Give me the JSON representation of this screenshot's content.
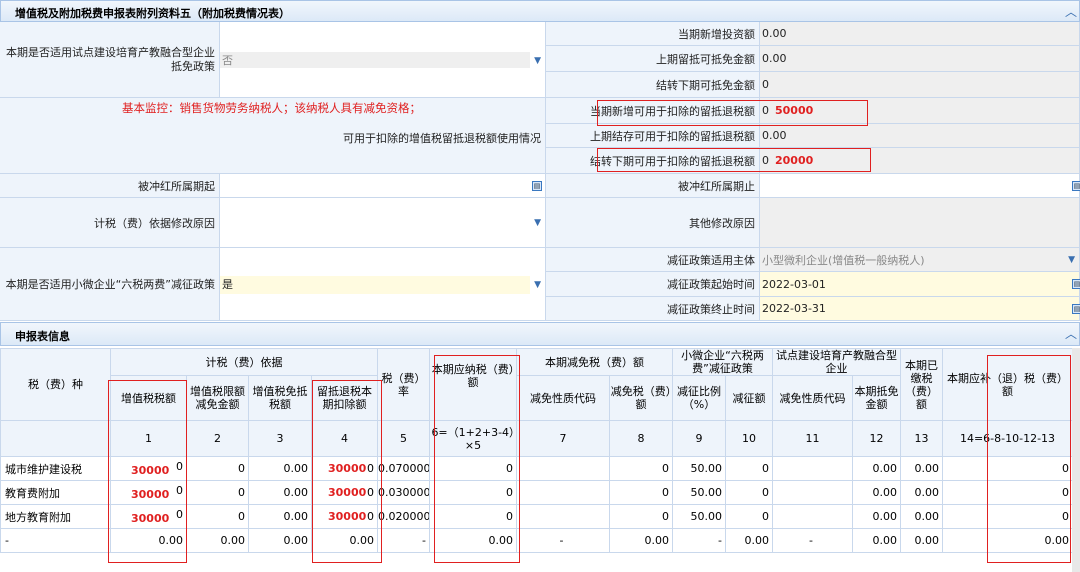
{
  "sections": {
    "main_title": "增值税及附加税费申报表附列资料五（附加税费情况表）",
    "sub_title": "申报表信息"
  },
  "form": {
    "pilot_policy_label": "本期是否适用试点建设培育产教融合型企业抵免政策",
    "pilot_policy_value": "否",
    "monitor_note": "基本监控：销售货物劳务纳税人；该纳税人具有减免资格；",
    "refund_usage_label": "可用于扣除的增值税留抵退税额使用情况",
    "new_investment_label": "当期新增投资额",
    "new_investment_value": "0.00",
    "prev_credit_label": "上期留抵可抵免金额",
    "prev_credit_value": "0.00",
    "carry_credit_label": "结转下期可抵免金额",
    "carry_credit_value": "0",
    "new_refund_label": "当期新增可用于扣除的留抵退税额",
    "new_refund_value": "0",
    "new_refund_note": "50000",
    "prev_refund_label": "上期结存可用于扣除的留抵退税额",
    "prev_refund_value": "0.00",
    "carry_refund_label": "结转下期可用于扣除的留抵退税额",
    "carry_refund_value": "0",
    "carry_refund_note": "20000",
    "red_start_label": "被冲红所属期起",
    "red_end_label": "被冲红所属期止",
    "basis_reason_label": "计税（费）依据修改原因",
    "other_reason_label": "其他修改原因",
    "six_tax_label": "本期是否适用小微企业“六税两费”减征政策",
    "six_tax_value": "是",
    "reduce_subject_label": "减征政策适用主体",
    "reduce_subject_value": "小型微利企业(增值税一般纳税人)",
    "reduce_start_label": "减征政策起始时间",
    "reduce_start_value": "2022-03-01",
    "reduce_end_label": "减征政策终止时间",
    "reduce_end_value": "2022-03-31"
  },
  "table": {
    "h": {
      "tax_type": "税（费）种",
      "basis": "计税（费）依据",
      "c1": "增值税税额",
      "c2": "增值税限额减免金额",
      "c3": "增值税免抵税额",
      "c4": "留抵退税本期扣除额",
      "rate": "税（费）率",
      "payable": "本期应纳税（费）额",
      "reduce": "本期减免税（费）额",
      "r_code": "减免性质代码",
      "r_amt": "减免税（费）额",
      "small": "小微企业“六税两费”减征政策",
      "ratio": "减征比例（%）",
      "r_amount": "减征额",
      "pilot": "试点建设培育产教融合型企业",
      "p_code": "减免性质代码",
      "p_amt": "本期抵免金额",
      "paid": "本期已缴税（费）额",
      "due": "本期应补（退）税（费）额"
    },
    "nums": [
      "1",
      "2",
      "3",
      "4",
      "5",
      "6=（1+2+3-4）×5",
      "7",
      "8",
      "9",
      "10",
      "11",
      "12",
      "13",
      "14=6-8-10-12-13"
    ],
    "rows": [
      {
        "name": "城市维护建设税",
        "v1": "0",
        "n1": "30000",
        "v2": "0",
        "v3": "0.00",
        "v4": "0",
        "n4": "30000",
        "v5": "0.070000",
        "v6": "0",
        "v7": "",
        "v8": "0",
        "v9": "50.00",
        "v10": "0",
        "v11": "",
        "v12": "0.00",
        "v13": "0.00",
        "v14": "0"
      },
      {
        "name": "教育费附加",
        "v1": "0",
        "n1": "30000",
        "v2": "0",
        "v3": "0.00",
        "v4": "0",
        "n4": "30000",
        "v5": "0.030000",
        "v6": "0",
        "v7": "",
        "v8": "0",
        "v9": "50.00",
        "v10": "0",
        "v11": "",
        "v12": "0.00",
        "v13": "0.00",
        "v14": "0"
      },
      {
        "name": "地方教育附加",
        "v1": "0",
        "n1": "30000",
        "v2": "0",
        "v3": "0.00",
        "v4": "0",
        "n4": "30000",
        "v5": "0.020000",
        "v6": "0",
        "v7": "",
        "v8": "0",
        "v9": "50.00",
        "v10": "0",
        "v11": "",
        "v12": "0.00",
        "v13": "0.00",
        "v14": "0"
      },
      {
        "name": "-",
        "v1": "0.00",
        "n1": "",
        "v2": "0.00",
        "v3": "0.00",
        "v4": "0.00",
        "n4": "",
        "v5": "-",
        "v6": "0.00",
        "v7": "-",
        "v8": "0.00",
        "v9": "-",
        "v10": "0.00",
        "v11": "-",
        "v12": "0.00",
        "v13": "0.00",
        "v14": "0.00"
      }
    ]
  }
}
